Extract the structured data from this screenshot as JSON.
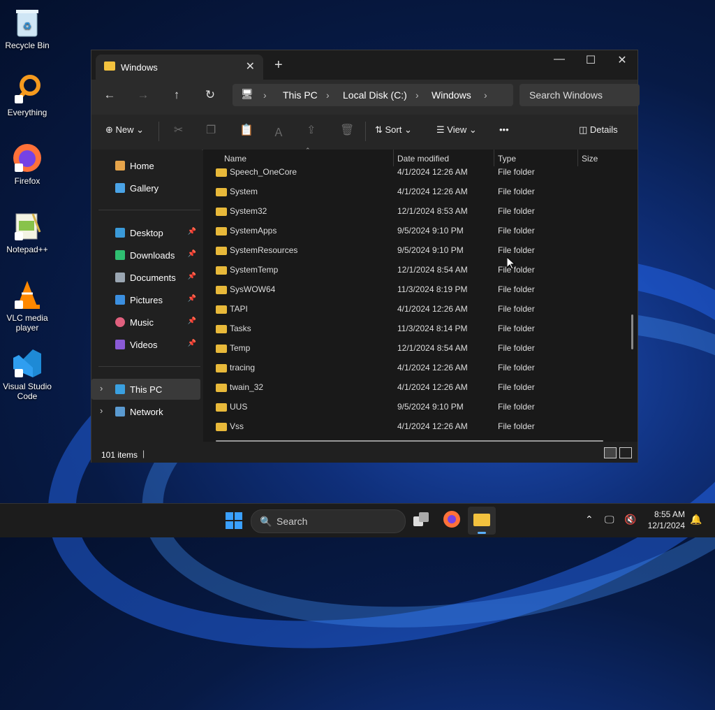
{
  "desktop": {
    "icons": [
      {
        "label": "Recycle Bin"
      },
      {
        "label": "Everything"
      },
      {
        "label": "Firefox"
      },
      {
        "label": "Notepad++"
      },
      {
        "label": "VLC media player"
      },
      {
        "label": "Visual Studio Code"
      }
    ]
  },
  "window": {
    "tab_title": "Windows",
    "close_tab": "✕",
    "new_tab": "+",
    "minimize": "—",
    "maximize": "☐",
    "close": "✕",
    "nav": {
      "back": "←",
      "forward": "→",
      "up": "↑",
      "refresh": "↻"
    },
    "breadcrumb": [
      "This PC",
      "Local Disk (C:)",
      "Windows"
    ],
    "search_placeholder": "Search Windows",
    "toolbar": {
      "new": "New",
      "sort": "Sort",
      "view": "View",
      "more": "•••",
      "details": "Details"
    },
    "sidebar": {
      "quick": [
        {
          "label": "Home"
        },
        {
          "label": "Gallery"
        }
      ],
      "pinned": [
        {
          "label": "Desktop"
        },
        {
          "label": "Downloads"
        },
        {
          "label": "Documents"
        },
        {
          "label": "Pictures"
        },
        {
          "label": "Music"
        },
        {
          "label": "Videos"
        }
      ],
      "locations": [
        {
          "label": "This PC"
        },
        {
          "label": "Network"
        }
      ]
    },
    "columns": {
      "name": "Name",
      "date": "Date modified",
      "type": "Type",
      "size": "Size"
    },
    "rows": [
      {
        "name": "Speech_OneCore",
        "date": "4/1/2024 12:26 AM",
        "type": "File folder"
      },
      {
        "name": "System",
        "date": "4/1/2024 12:26 AM",
        "type": "File folder"
      },
      {
        "name": "System32",
        "date": "12/1/2024 8:53 AM",
        "type": "File folder"
      },
      {
        "name": "SystemApps",
        "date": "9/5/2024 9:10 PM",
        "type": "File folder"
      },
      {
        "name": "SystemResources",
        "date": "9/5/2024 9:10 PM",
        "type": "File folder"
      },
      {
        "name": "SystemTemp",
        "date": "12/1/2024 8:54 AM",
        "type": "File folder"
      },
      {
        "name": "SysWOW64",
        "date": "11/3/2024 8:19 PM",
        "type": "File folder"
      },
      {
        "name": "TAPI",
        "date": "4/1/2024 12:26 AM",
        "type": "File folder"
      },
      {
        "name": "Tasks",
        "date": "11/3/2024 8:14 PM",
        "type": "File folder"
      },
      {
        "name": "Temp",
        "date": "12/1/2024 8:54 AM",
        "type": "File folder"
      },
      {
        "name": "tracing",
        "date": "4/1/2024 12:26 AM",
        "type": "File folder"
      },
      {
        "name": "twain_32",
        "date": "4/1/2024 12:26 AM",
        "type": "File folder"
      },
      {
        "name": "UUS",
        "date": "9/5/2024 9:10 PM",
        "type": "File folder"
      },
      {
        "name": "Vss",
        "date": "4/1/2024 12:26 AM",
        "type": "File folder"
      }
    ],
    "status": "101 items"
  },
  "taskbar": {
    "search": "Search",
    "time": "8:55 AM",
    "date": "12/1/2024"
  }
}
